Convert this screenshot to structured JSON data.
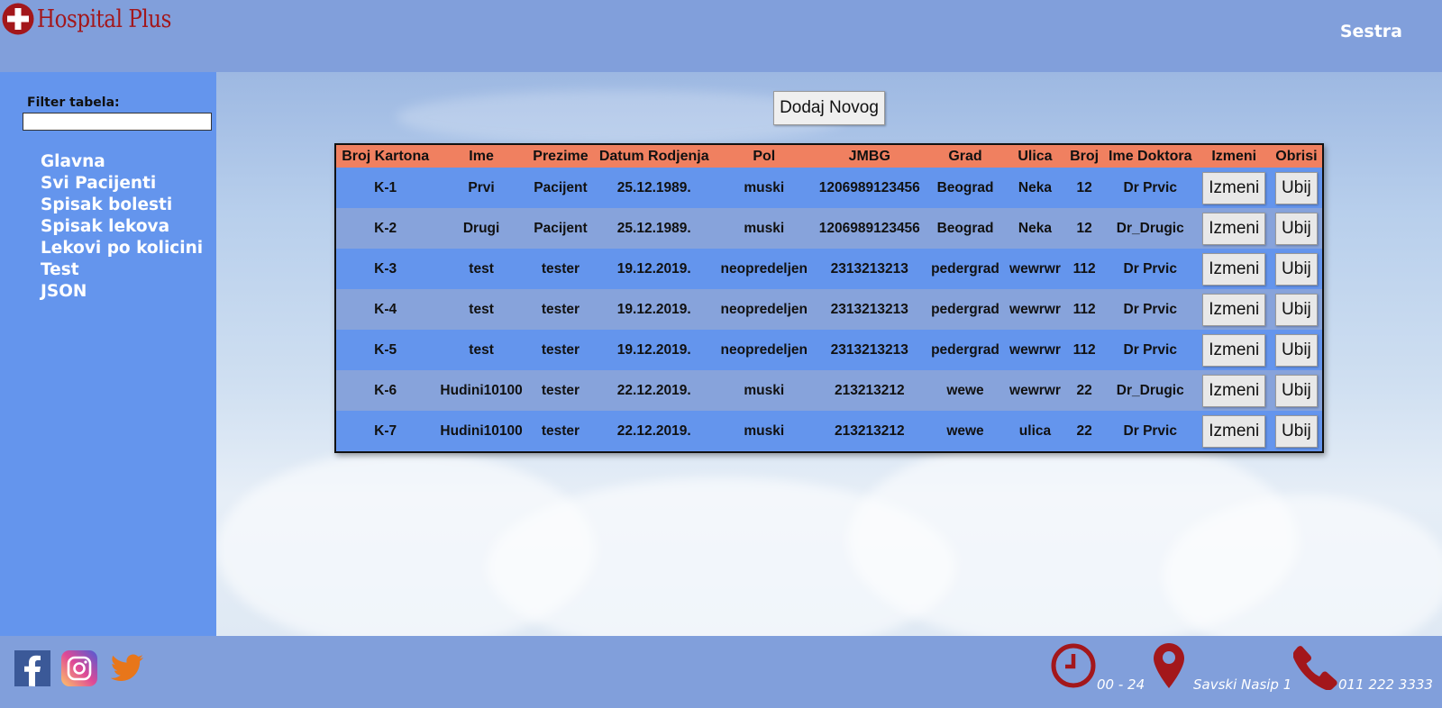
{
  "header": {
    "logo_text": "Hospital Plus",
    "role": "Sestra",
    "brand_color": "#a3171b"
  },
  "sidebar": {
    "filter_label": "Filter tabela:",
    "filter_value": "",
    "items": [
      {
        "label": "Glavna"
      },
      {
        "label": "Svi Pacijenti"
      },
      {
        "label": "Spisak bolesti"
      },
      {
        "label": "Spisak lekova"
      },
      {
        "label": "Lekovi po kolicini"
      },
      {
        "label": "Test"
      },
      {
        "label": "JSON"
      }
    ]
  },
  "main": {
    "add_button_label": "Dodaj Novog",
    "table": {
      "columns": [
        "Broj Kartona",
        "Ime",
        "Prezime",
        "Datum Rodjenja",
        "Pol",
        "JMBG",
        "Grad",
        "Ulica",
        "Broj",
        "Ime Doktora",
        "Izmeni",
        "Obrisi"
      ],
      "edit_label": "Izmeni",
      "delete_label": "Ubij",
      "rows": [
        [
          "K-1",
          "Prvi",
          "Pacijent",
          "25.12.1989.",
          "muski",
          "1206989123456",
          "Beograd",
          "Neka",
          "12",
          "Dr Prvic"
        ],
        [
          "K-2",
          "Drugi",
          "Pacijent",
          "25.12.1989.",
          "muski",
          "1206989123456",
          "Beograd",
          "Neka",
          "12",
          "Dr_Drugic"
        ],
        [
          "K-3",
          "test",
          "tester",
          "19.12.2019.",
          "neopredeljen",
          "2313213213",
          "pedergrad",
          "wewrwr",
          "112",
          "Dr Prvic"
        ],
        [
          "K-4",
          "test",
          "tester",
          "19.12.2019.",
          "neopredeljen",
          "2313213213",
          "pedergrad",
          "wewrwr",
          "112",
          "Dr Prvic"
        ],
        [
          "K-5",
          "test",
          "tester",
          "19.12.2019.",
          "neopredeljen",
          "2313213213",
          "pedergrad",
          "wewrwr",
          "112",
          "Dr Prvic"
        ],
        [
          "K-6",
          "Hudini10100",
          "tester",
          "22.12.2019.",
          "muski",
          "213213212",
          "wewe",
          "wewrwr",
          "22",
          "Dr_Drugic"
        ],
        [
          "K-7",
          "Hudini10100",
          "tester",
          "22.12.2019.",
          "muski",
          "213213212",
          "wewe",
          "ulica",
          "22",
          "Dr Prvic"
        ]
      ]
    }
  },
  "footer": {
    "social": [
      {
        "icon": "facebook-icon"
      },
      {
        "icon": "instagram-icon"
      },
      {
        "icon": "twitter-icon"
      }
    ],
    "hours": "00 - 24",
    "address": "Savski Nasip 1",
    "phone": "011 222 3333",
    "icon_color": "#a3171b"
  }
}
